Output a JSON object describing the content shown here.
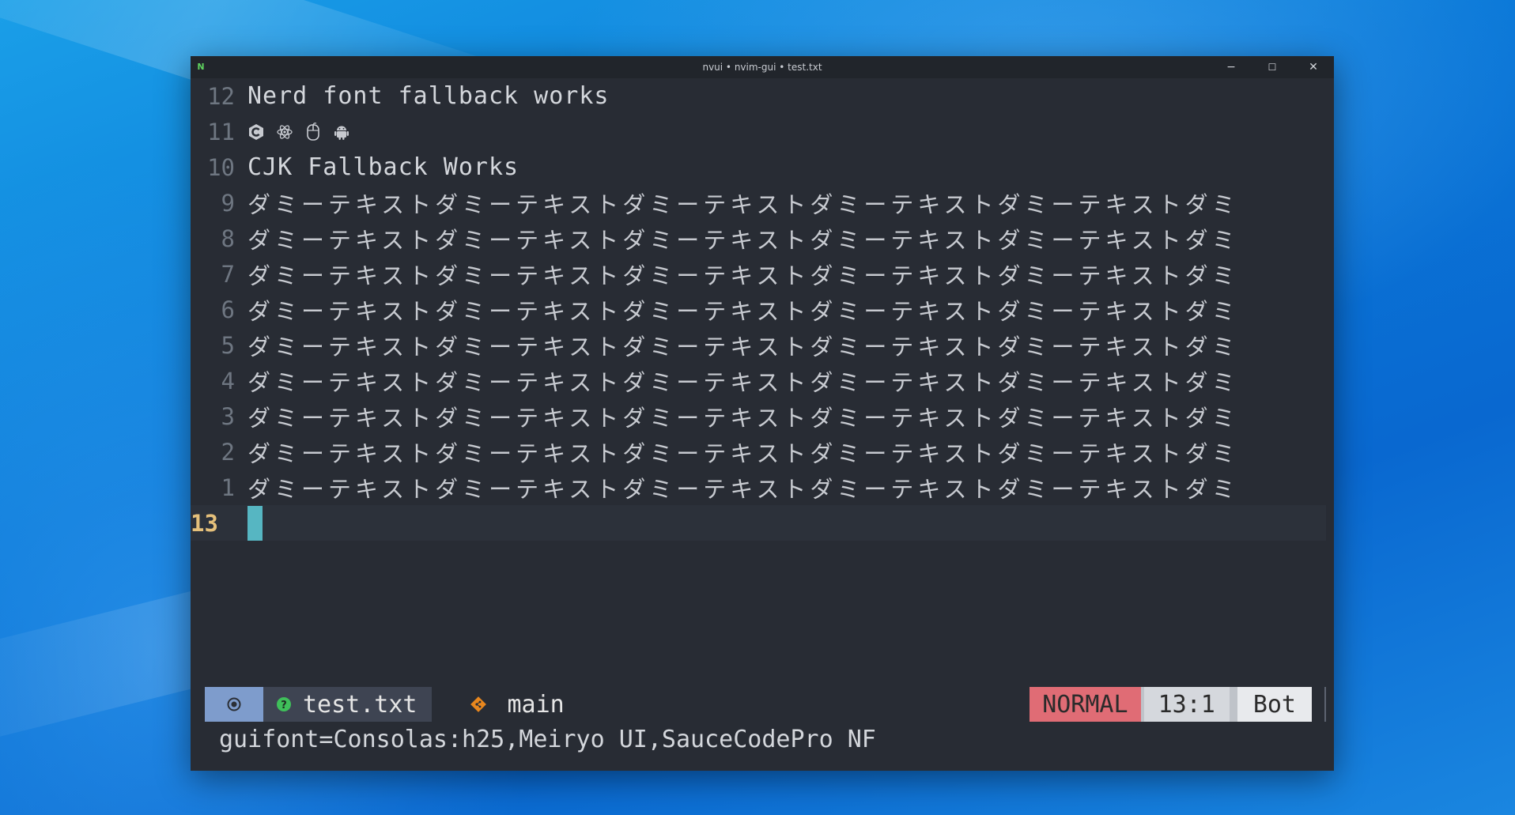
{
  "window": {
    "title": "nvui • nvim-gui • test.txt",
    "app_icon": "N",
    "minimize_glyph": "−",
    "maximize_glyph": "☐",
    "close_glyph": "✕"
  },
  "lines": [
    {
      "number": "12",
      "text": "Nerd font fallback works"
    },
    {
      "number": "11",
      "icons": [
        "c-lang-icon",
        "electron-icon",
        "mouse-icon",
        "android-icon"
      ]
    },
    {
      "number": "10",
      "text": "CJK Fallback Works"
    },
    {
      "number": "9",
      "text": "ダミーテキストダミーテキストダミーテキストダミーテキストダミーテキストダミ"
    },
    {
      "number": "8",
      "text": "ダミーテキストダミーテキストダミーテキストダミーテキストダミーテキストダミ"
    },
    {
      "number": "7",
      "text": "ダミーテキストダミーテキストダミーテキストダミーテキストダミーテキストダミ"
    },
    {
      "number": "6",
      "text": "ダミーテキストダミーテキストダミーテキストダミーテキストダミーテキストダミ"
    },
    {
      "number": "5",
      "text": "ダミーテキストダミーテキストダミーテキストダミーテキストダミーテキストダミ"
    },
    {
      "number": "4",
      "text": "ダミーテキストダミーテキストダミーテキストダミーテキストダミーテキストダミ"
    },
    {
      "number": "3",
      "text": "ダミーテキストダミーテキストダミーテキストダミーテキストダミーテキストダミ"
    },
    {
      "number": "2",
      "text": "ダミーテキストダミーテキストダミーテキストダミーテキストダミーテキストダミ"
    },
    {
      "number": "1",
      "text": "ダミーテキストダミーテキストダミーテキストダミーテキストダミーテキストダミ"
    },
    {
      "number": "13",
      "text": ""
    }
  ],
  "statusline": {
    "mode_icon": "record-icon",
    "file_status_icon": "question-icon",
    "file_name": "test.txt",
    "branch_icon": "git-branch-icon",
    "branch": "main",
    "mode": "NORMAL",
    "position": "13:1",
    "scroll": "Bot"
  },
  "cmdline": "guifont=Consolas:h25,Meiryo UI,SauceCodePro NF",
  "colors": {
    "editor_bg": "#282c34",
    "mode_normal": "#e06c75",
    "cursor": "#56b6c2",
    "current_line_number": "#e5c07b"
  }
}
